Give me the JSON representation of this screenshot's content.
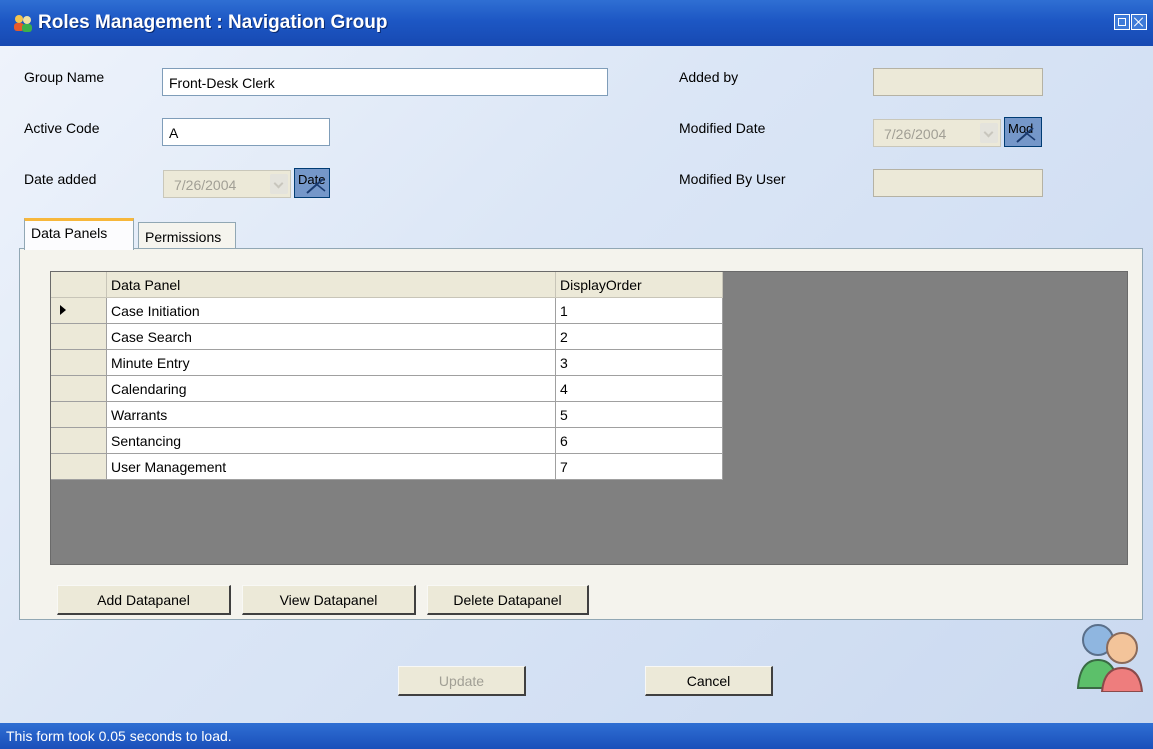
{
  "window": {
    "title": "Roles Management : Navigation Group"
  },
  "form": {
    "group_name_label": "Group Name",
    "group_name_value": "Front-Desk Clerk",
    "active_code_label": "Active Code",
    "active_code_value": "A",
    "date_added_label": "Date added",
    "date_added_value": "7/26/2004",
    "date_added_button": "Date",
    "added_by_label": "Added by",
    "added_by_value": "",
    "modified_date_label": "Modified Date",
    "modified_date_value": "7/26/2004",
    "modified_date_button": "Mod",
    "modified_by_label": "Modified By User",
    "modified_by_value": ""
  },
  "tabs": [
    {
      "label": "Data Panels",
      "active": true
    },
    {
      "label": "Permissions",
      "active": false
    }
  ],
  "grid": {
    "columns": [
      "Data Panel",
      "DisplayOrder"
    ],
    "rows": [
      {
        "panel": "Case Initiation",
        "order": "1",
        "current": true
      },
      {
        "panel": "Case Search",
        "order": "2"
      },
      {
        "panel": "Minute Entry",
        "order": "3"
      },
      {
        "panel": "Calendaring",
        "order": "4"
      },
      {
        "panel": "Warrants",
        "order": "5"
      },
      {
        "panel": "Sentancing",
        "order": "6"
      },
      {
        "panel": "User Management",
        "order": "7"
      }
    ]
  },
  "panel_buttons": {
    "add": "Add Datapanel",
    "view": "View Datapanel",
    "delete": "Delete Datapanel"
  },
  "actions": {
    "update": "Update",
    "update_enabled": false,
    "cancel": "Cancel"
  },
  "status": {
    "text": "This form took 0.05 seconds to load."
  },
  "colors": {
    "titlebar": "#1d57c4",
    "tab_highlight": "#f7b73b",
    "grid_background": "#808080"
  },
  "icons": {
    "app": "users-icon",
    "maximize": "restore-icon",
    "close": "close-icon",
    "calendar_pick": "pencil-icon",
    "corner": "users-group-icon"
  }
}
